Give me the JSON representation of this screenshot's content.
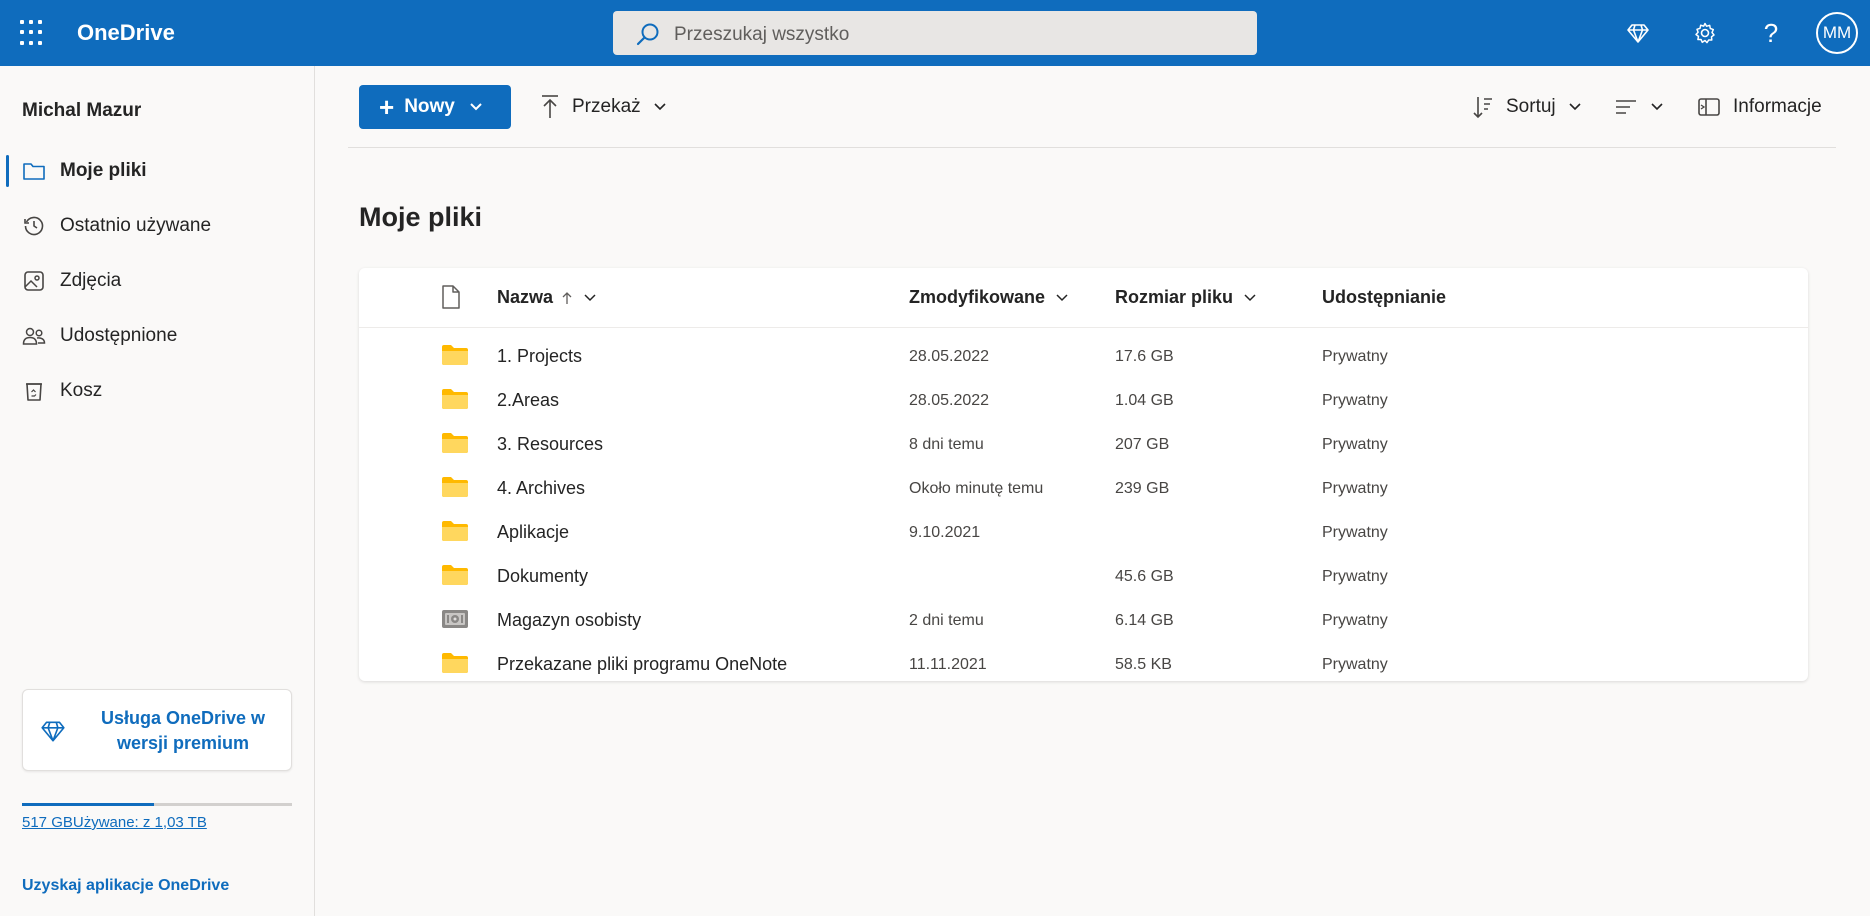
{
  "app": {
    "name": "OneDrive"
  },
  "search": {
    "placeholder": "Przeszukaj wszystko"
  },
  "user": {
    "name": "Michal Mazur",
    "initials": "MM"
  },
  "sidebar": {
    "items": [
      {
        "label": "Moje pliki",
        "icon": "folder-icon",
        "active": true
      },
      {
        "label": "Ostatnio używane",
        "icon": "history-icon",
        "active": false
      },
      {
        "label": "Zdjęcia",
        "icon": "photo-icon",
        "active": false
      },
      {
        "label": "Udostępnione",
        "icon": "people-icon",
        "active": false
      },
      {
        "label": "Kosz",
        "icon": "recycle-bin-icon",
        "active": false
      }
    ],
    "premium": "Usługa OneDrive w wersji premium",
    "storage": {
      "text": "517 GBUżywane: z 1,03 TB",
      "used_fraction": 0.49
    },
    "get_apps": "Uzyskaj aplikacje OneDrive"
  },
  "toolbar": {
    "new": "Nowy",
    "upload": "Przekaż",
    "sort": "Sortuj",
    "info": "Informacje"
  },
  "page": {
    "title": "Moje pliki"
  },
  "table": {
    "columns": {
      "name": "Nazwa",
      "modified": "Zmodyfikowane",
      "size": "Rozmiar pliku",
      "sharing": "Udostępnianie"
    },
    "rows": [
      {
        "name": "1. Projects",
        "modified": "28.05.2022",
        "size": "17.6 GB",
        "sharing": "Prywatny",
        "icon": "folder-icon"
      },
      {
        "name": "2.Areas",
        "modified": "28.05.2022",
        "size": "1.04 GB",
        "sharing": "Prywatny",
        "icon": "folder-icon"
      },
      {
        "name": "3. Resources",
        "modified": "8 dni temu",
        "size": "207 GB",
        "sharing": "Prywatny",
        "icon": "folder-icon"
      },
      {
        "name": "4. Archives",
        "modified": "Około minutę temu",
        "size": "239 GB",
        "sharing": "Prywatny",
        "icon": "folder-icon"
      },
      {
        "name": "Aplikacje",
        "modified": "9.10.2021",
        "size": "",
        "sharing": "Prywatny",
        "icon": "folder-icon"
      },
      {
        "name": "Dokumenty",
        "modified": "",
        "size": "45.6 GB",
        "sharing": "Prywatny",
        "icon": "folder-icon"
      },
      {
        "name": "Magazyn osobisty",
        "modified": "2 dni temu",
        "size": "6.14 GB",
        "sharing": "Prywatny",
        "icon": "vault-icon"
      },
      {
        "name": "Przekazane pliki programu OneNote",
        "modified": "11.11.2021",
        "size": "58.5 KB",
        "sharing": "Prywatny",
        "icon": "folder-icon"
      }
    ]
  },
  "colors": {
    "accent": "#0f6cbd",
    "folder": "#ffd75e"
  }
}
